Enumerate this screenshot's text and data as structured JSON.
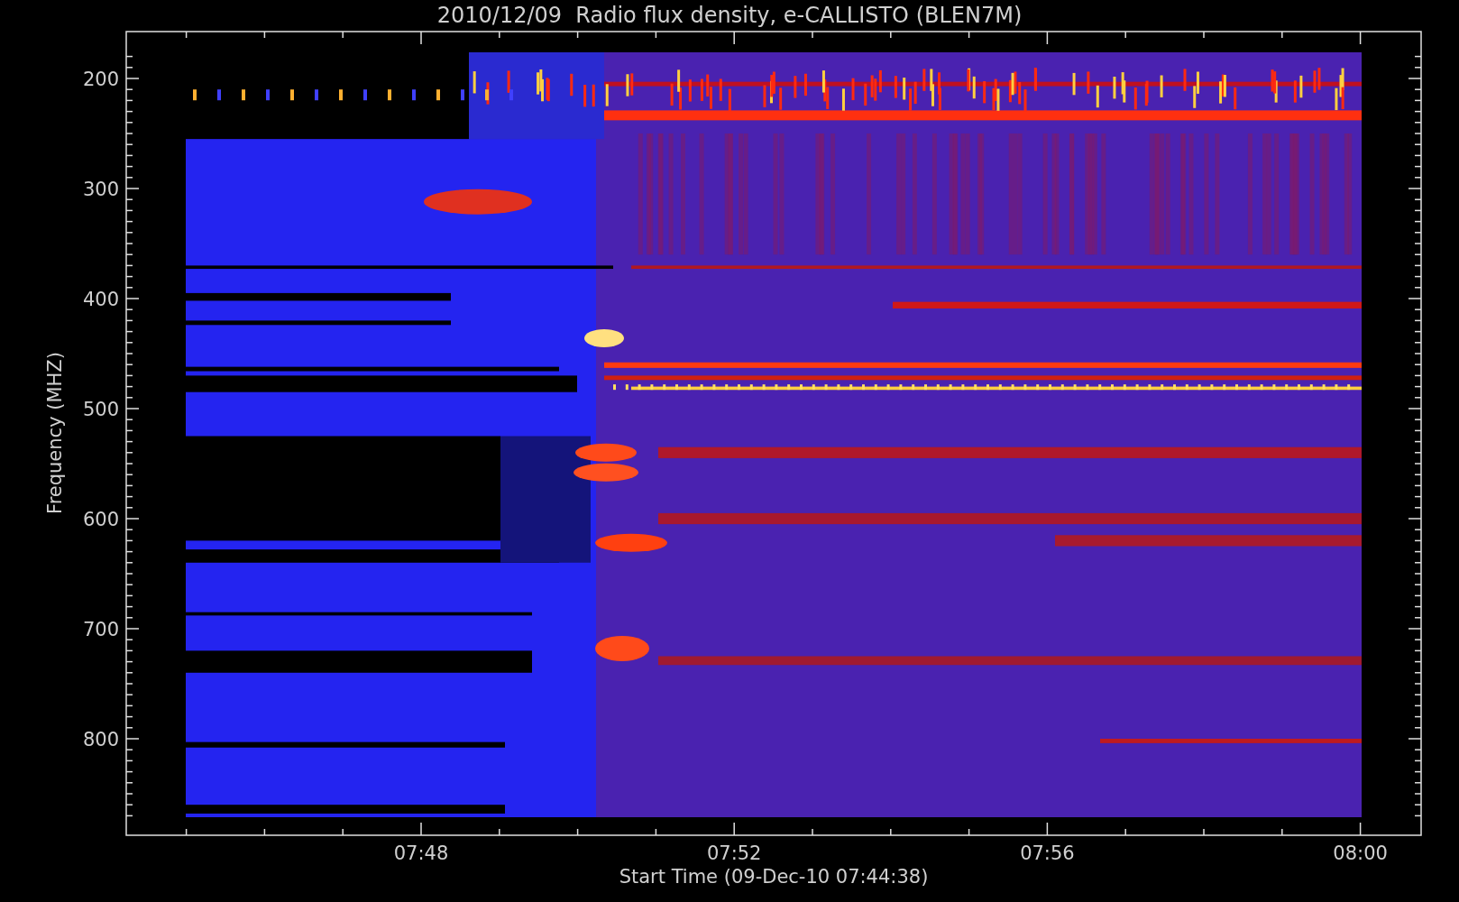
{
  "title": "2010/12/09  Radio flux density, e-CALLISTO (BLEN7M)",
  "y_axis": {
    "label": "Frequency (MHZ)",
    "ticks": [
      "200",
      "300",
      "400",
      "500",
      "600",
      "700",
      "800"
    ]
  },
  "x_axis": {
    "label": "Start Time (09-Dec-10 07:44:38)",
    "ticks": [
      "07:48",
      "07:52",
      "07:56",
      "08:00"
    ]
  }
}
